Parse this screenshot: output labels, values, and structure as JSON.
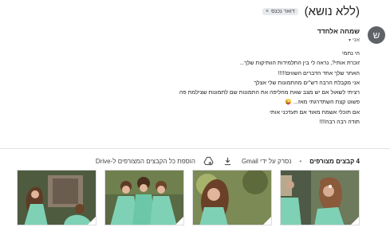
{
  "subject": {
    "title": "(ללא נושא)",
    "label_chip": "דואר נכנס",
    "chip_remove": "×"
  },
  "sender": {
    "avatar_letter": "ש",
    "name": "שמחה אלחדד",
    "to": "אני",
    "to_chevron": "▾"
  },
  "message": {
    "lines": [
      "הי נחמי",
      "זוכרת אותי?, נראה לי בין התלמידות הוותיקות שלך...",
      "האתר שלך אחד הדברים השווים!!!!!",
      "אני מקבלת הרבה דש\"ים מהתמונות שלי אצלך",
      "רציתי לשאול אם יש מצב שאת מחליפה את התמונות שם לתמונות שצילמת פה",
      "פשוט קצת השתדרגתי מאז... 😜",
      "אם תוכלי אשמח מאוד אם תעדכני אותי",
      "תודה רבה רבה!!!!"
    ]
  },
  "attachments": {
    "count_label": "4 קבצים מצורפים",
    "scan_label": "נסרק על ידי Gmail",
    "separator": "•",
    "add_drive_label": "הוספת כל הקבצים המצורפים ל-Drive",
    "download_icon": "download-icon",
    "drive_icon": "add-to-drive-icon"
  },
  "colors": {
    "avatar_bg": "#5f6368",
    "chip_bg": "#e8eaed",
    "dress_green": "#7fd1b5"
  }
}
